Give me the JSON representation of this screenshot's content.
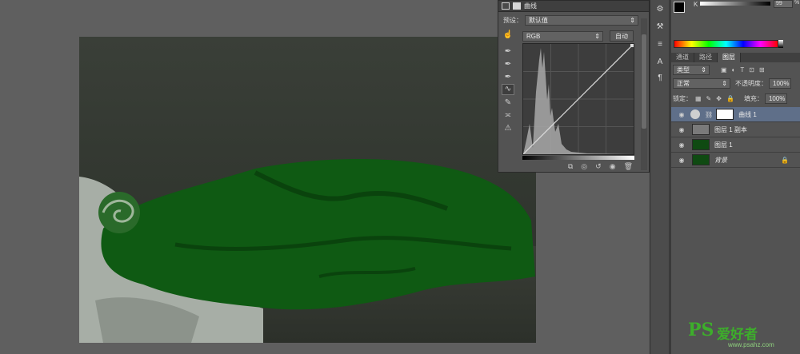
{
  "properties": {
    "title": "曲线",
    "preset_label": "预设：",
    "preset_value": "默认值",
    "channel_value": "RGB",
    "auto_button": "自动"
  },
  "color_panel": {
    "k_label": "K",
    "k_value": "99",
    "percent": "%"
  },
  "layers_panel": {
    "tabs": [
      "通道",
      "路径",
      "图层"
    ],
    "active_tab": "图层",
    "filter_kind": "类型",
    "blend_mode": "正常",
    "opacity_label": "不透明度：",
    "opacity_value": "100%",
    "lock_label": "锁定：",
    "fill_label": "填充：",
    "fill_value": "100%",
    "layers": [
      {
        "name": "曲线 1",
        "selected": true,
        "type": "adjustment"
      },
      {
        "name": "图层 1 副本",
        "selected": false,
        "type": "gray"
      },
      {
        "name": "图层 1",
        "selected": false,
        "type": "green"
      },
      {
        "name": "背景",
        "selected": false,
        "type": "green",
        "locked": true
      }
    ]
  },
  "watermark": {
    "logo": "PS",
    "text": "爱好者",
    "url": "www.psahz.com"
  },
  "colors": {
    "accent_selection": "#5f6f89",
    "dress_green": "#0e5a12"
  }
}
